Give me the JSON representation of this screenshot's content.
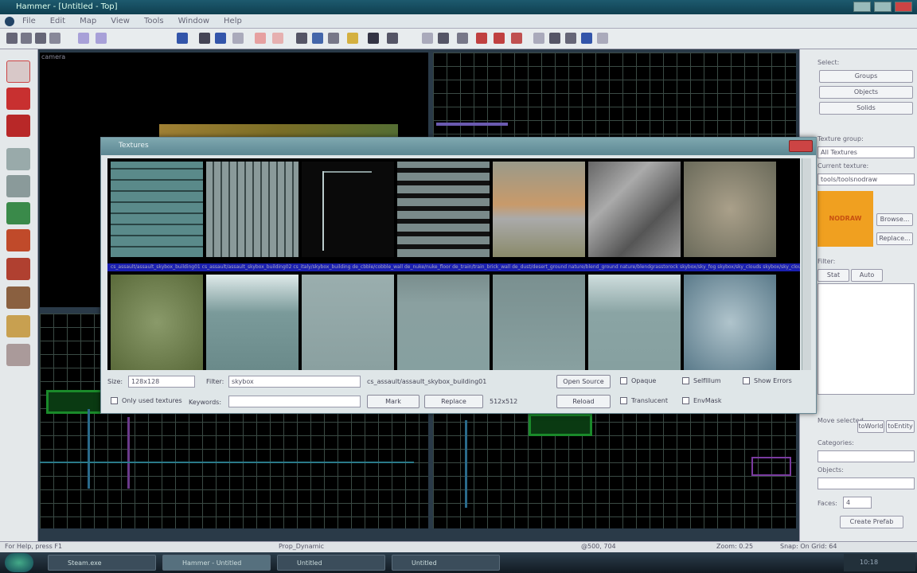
{
  "app": {
    "title": "Hammer - [Untitled - Top]"
  },
  "menu": [
    "File",
    "Edit",
    "Map",
    "View",
    "Tools",
    "Window",
    "Help"
  ],
  "viewports": {
    "camera_label": "camera",
    "top_label": "",
    "side_label": "",
    "front_label": ""
  },
  "right_panel": {
    "select_label": "Select:",
    "groups_btn": "Groups",
    "objects_btn": "Objects",
    "solids_btn": "Solids",
    "texture_group_label": "Texture group:",
    "texture_group_value": "All Textures",
    "current_texture_label": "Current texture:",
    "current_texture_value": "tools/toolsnodraw",
    "texture_tile_text": "NODRAW",
    "browse_btn": "Browse...",
    "replace_btn": "Replace...",
    "filter_label": "Filter:",
    "tab1": "Stat",
    "tab2": "Auto",
    "move_selected_label": "Move selected",
    "to_world_btn": "toWorld",
    "to_entity_btn": "toEntity",
    "categories_label": "Categories:",
    "objects_label": "Objects:",
    "faces_label": "Faces:",
    "faces_value": "4",
    "create_prefab_btn": "Create Prefab"
  },
  "dialog": {
    "title": "Textures",
    "selected_bar_text": "cs_assault/assault_skybox_building01  cs_assault/assault_skybox_building02  cs_italy/skybox_building  de_cbble/cobble_wall  de_nuke/nuke_floor  de_train/train_brick_wall  de_dust/desert_ground  nature/blend_ground  nature/blendgrasstorock  skybox/sky_fog  skybox/sky_clouds  skybox/sky_cloud  nature/water",
    "size_label": "Size:",
    "size_value": "128x128",
    "filter_label": "Filter:",
    "filter_value": "skybox",
    "selected_name": "cs_assault/assault_skybox_building01",
    "mark_button": "Mark",
    "replace_button": "Replace",
    "reload_button": "Reload",
    "open_source_button": "Open Source",
    "only_used_label": "Only used textures",
    "keywords_label": "Keywords:",
    "keywords_value": "",
    "dimensions_value": "512x512",
    "opaque_label": "Opaque",
    "translucent_label": "Translucent",
    "selfillum_label": "SelfIllum",
    "envmask_label": "EnvMask",
    "show_errors_label": "Show Errors"
  },
  "status": {
    "left": "For Help, press F1",
    "middle": "Prop_Dynamic",
    "coords": "@500, 704",
    "size": "Snap: On Grid: 64",
    "zoom": "Zoom: 0.25"
  },
  "taskbar": {
    "tasks": [
      "Steam.exe",
      "Hammer - Untitled",
      "Untitled",
      "Untitled"
    ],
    "clock": "10:18"
  }
}
